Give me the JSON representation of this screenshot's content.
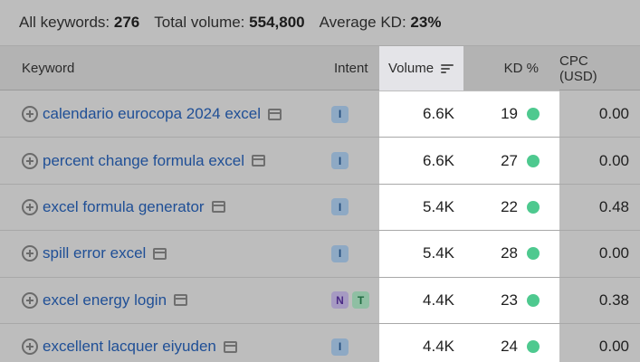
{
  "summary": {
    "all_keywords_label": "All keywords:",
    "all_keywords_value": "276",
    "total_volume_label": "Total volume:",
    "total_volume_value": "554,800",
    "avg_kd_label": "Average KD:",
    "avg_kd_value": "23%"
  },
  "columns": {
    "keyword": "Keyword",
    "intent": "Intent",
    "volume": "Volume",
    "kd": "KD %",
    "cpc": "CPC (USD)"
  },
  "colors": {
    "kd_easy": "#4ec98f",
    "link": "#1f4f96"
  },
  "rows": [
    {
      "keyword": "calendario eurocopa 2024 excel",
      "intents": [
        "I"
      ],
      "volume": "6.6K",
      "kd": "19",
      "cpc": "0.00"
    },
    {
      "keyword": "percent change formula excel",
      "intents": [
        "I"
      ],
      "volume": "6.6K",
      "kd": "27",
      "cpc": "0.00"
    },
    {
      "keyword": "excel formula generator",
      "intents": [
        "I"
      ],
      "volume": "5.4K",
      "kd": "22",
      "cpc": "0.48"
    },
    {
      "keyword": "spill error excel",
      "intents": [
        "I"
      ],
      "volume": "5.4K",
      "kd": "28",
      "cpc": "0.00"
    },
    {
      "keyword": "excel energy login",
      "intents": [
        "N",
        "T"
      ],
      "volume": "4.4K",
      "kd": "23",
      "cpc": "0.38"
    },
    {
      "keyword": "excellent lacquer eiyuden",
      "intents": [
        "I"
      ],
      "volume": "4.4K",
      "kd": "24",
      "cpc": "0.00"
    }
  ]
}
